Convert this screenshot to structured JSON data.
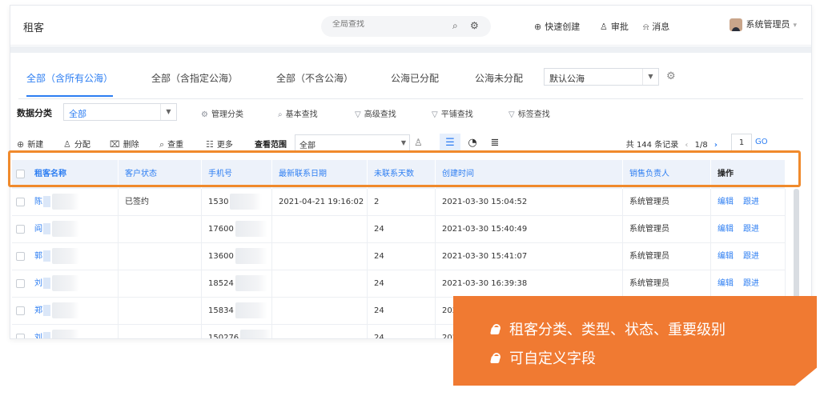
{
  "header": {
    "title": "租客",
    "search_placeholder": "全局查找",
    "quick_create": "快速创建",
    "approve": "审批",
    "messages": "消息",
    "user": "系统管理员"
  },
  "tabs": [
    "全部（含所有公海）",
    "全部（含指定公海）",
    "全部（不含公海）",
    "公海已分配",
    "公海未分配"
  ],
  "active_tab_index": 0,
  "sea_select": "默认公海",
  "filter": {
    "label": "数据分类",
    "category": "全部",
    "links": [
      "管理分类",
      "基本查找",
      "高级查找",
      "平铺查找",
      "标签查找"
    ]
  },
  "toolbar": {
    "new": "新建",
    "assign": "分配",
    "delete": "删除",
    "duplicate": "查重",
    "more": "更多",
    "scope_label": "查看范围",
    "scope_value": "全部",
    "record_count": "共 144 条记录",
    "page_info": "1/8",
    "page_input": "1",
    "go": "GO"
  },
  "table": {
    "columns": [
      "租客名称",
      "客户状态",
      "手机号",
      "最新联系日期",
      "未联系天数",
      "创建时间",
      "销售负责人",
      "操作"
    ],
    "rows": [
      {
        "name": "陈",
        "status": "已签约",
        "phone": "1530",
        "last_contact": "2021-04-21 19:16:02",
        "days": "2",
        "created": "2021-03-30 15:04:52",
        "owner": "系统管理员"
      },
      {
        "name": "阎",
        "status": "",
        "phone": "17600",
        "last_contact": "",
        "days": "24",
        "created": "2021-03-30 15:40:49",
        "owner": "系统管理员"
      },
      {
        "name": "郭",
        "status": "",
        "phone": "13600",
        "last_contact": "",
        "days": "24",
        "created": "2021-03-30 15:41:07",
        "owner": "系统管理员"
      },
      {
        "name": "刘",
        "status": "",
        "phone": "18524",
        "last_contact": "",
        "days": "24",
        "created": "2021-03-30 16:39:38",
        "owner": "系统管理员"
      },
      {
        "name": "郑",
        "status": "",
        "phone": "15834",
        "last_contact": "",
        "days": "24",
        "created": "202",
        "owner": ""
      },
      {
        "name": "刘",
        "status": "",
        "phone": "150276",
        "last_contact": "",
        "days": "24",
        "created": "202",
        "owner": ""
      }
    ],
    "ops": {
      "edit": "编辑",
      "follow": "跟进"
    }
  },
  "promo": {
    "items": [
      "租客分类、类型、状态、重要级别",
      "可自定义字段"
    ],
    "color": "#f07a32"
  },
  "colors": {
    "accent": "#2d7ef2",
    "highlight": "#f08a2c"
  }
}
